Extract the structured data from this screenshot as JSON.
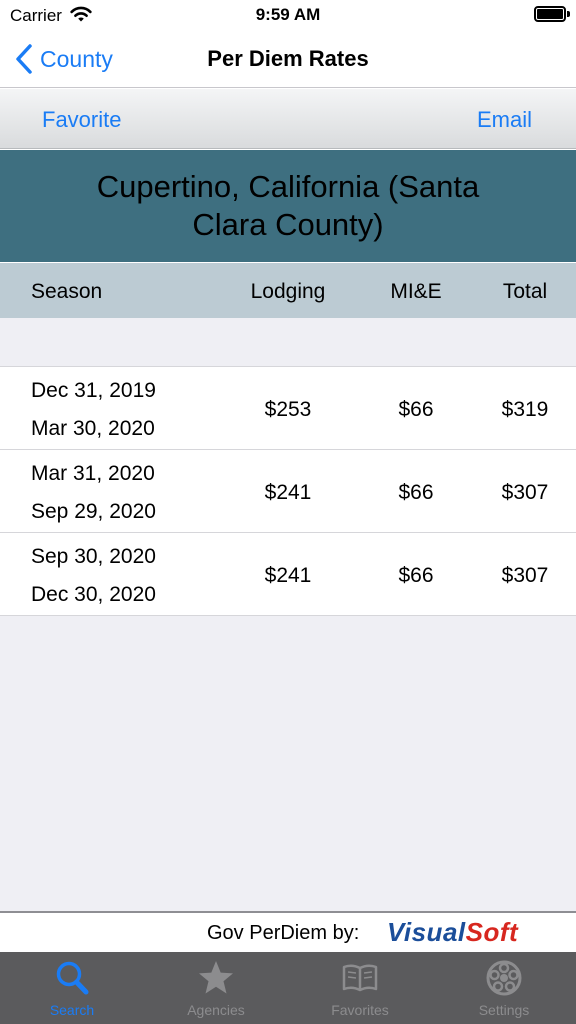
{
  "status_bar": {
    "carrier": "Carrier",
    "time": "9:59 AM"
  },
  "nav": {
    "back_label": "County",
    "title": "Per Diem Rates"
  },
  "toolbar": {
    "favorite_label": "Favorite",
    "email_label": "Email"
  },
  "location": {
    "name": "Cupertino, California (Santa Clara County)"
  },
  "table": {
    "headers": {
      "season": "Season",
      "lodging": "Lodging",
      "mie": "MI&E",
      "total": "Total"
    },
    "rows": [
      {
        "start": "Dec 31, 2019",
        "end": "Mar 30, 2020",
        "lodging": "$253",
        "mie": "$66",
        "total": "$319"
      },
      {
        "start": "Mar 31, 2020",
        "end": "Sep 29, 2020",
        "lodging": "$241",
        "mie": "$66",
        "total": "$307"
      },
      {
        "start": "Sep 30, 2020",
        "end": "Dec 30, 2020",
        "lodging": "$241",
        "mie": "$66",
        "total": "$307"
      }
    ]
  },
  "brand": {
    "by_text": "Gov PerDiem by:",
    "logo_part1": "Visual",
    "logo_part2": "Soft"
  },
  "tabs": [
    {
      "label": "Search",
      "icon": "search-icon",
      "active": true
    },
    {
      "label": "Agencies",
      "icon": "star-icon",
      "active": false
    },
    {
      "label": "Favorites",
      "icon": "book-icon",
      "active": false
    },
    {
      "label": "Settings",
      "icon": "gear-icon",
      "active": false
    }
  ],
  "colors": {
    "accent": "#1a7cf5",
    "location_header_bg": "#3e6f80",
    "table_header_bg": "#bccbd3",
    "tab_bar_bg": "#5b5b5d",
    "logo_blue": "#1b4e9a",
    "logo_red": "#d7271f"
  }
}
